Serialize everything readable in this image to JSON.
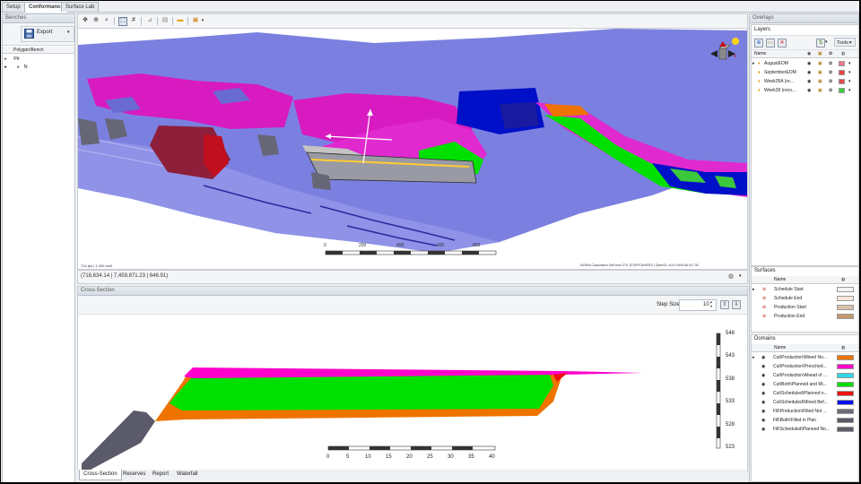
{
  "top_tabs": [
    "Setup",
    "Conformance",
    "Surface Lab"
  ],
  "benches": {
    "title": "Benches",
    "export_label": "Export",
    "column": "Polygon/Bench",
    "tree": [
      "Pit",
      "N"
    ]
  },
  "viewport": {
    "fps": "714 fps | 1.400 ms/f",
    "coords": "(718,634.14 | 7,459,871.23 | 646.91)",
    "gpu_info": "NVIDIA Corporation GeForce GTX 1070/PCIe/SSE2 | OpenGL v4.5.0 NVIDIA 417.35",
    "scale_labels": [
      "0",
      "200",
      "400",
      "600",
      "800"
    ]
  },
  "cross_section": {
    "title": "Cross-Section",
    "step_size_label": "Step Size",
    "step_size_value": "10",
    "elevation_labels": [
      "548",
      "543",
      "538",
      "533",
      "528",
      "523"
    ],
    "scale_labels": [
      "0",
      "5",
      "10",
      "15",
      "20",
      "25",
      "30",
      "35",
      "40"
    ]
  },
  "bottom_tabs": [
    "Cross-Section",
    "Reserves",
    "Report",
    "Waterfall"
  ],
  "overlays": {
    "title": "Overlays",
    "layers_label": "Layers",
    "tools_label": "Tools",
    "layers_column": "Name",
    "layers": [
      {
        "name": "AugustEOM",
        "color": "#f07a8a"
      },
      {
        "name": "SeptemberEOM",
        "color": "#e8463c"
      },
      {
        "name": "Week35A (re...",
        "color": "#e04a4a"
      },
      {
        "name": "Week39 (reco...",
        "color": "#3ccd3c"
      }
    ],
    "surfaces_label": "Surfaces",
    "surfaces_column": "Name",
    "surfaces": [
      {
        "name": "Schedule Start",
        "color": "#f4f4f4"
      },
      {
        "name": "Schedule End",
        "color": "#f9e6d8"
      },
      {
        "name": "Production Start",
        "color": "#dcc1a8"
      },
      {
        "name": "Production End",
        "color": "#c49a6c"
      }
    ],
    "domains_label": "Domains",
    "domains_column": "Name",
    "domains": [
      {
        "name": "Cut\\Production\\Mined No...",
        "color": "#ef7300"
      },
      {
        "name": "Cut\\Production\\Presched...",
        "color": "#ff00cc"
      },
      {
        "name": "Cut\\Production\\Ahead of ...",
        "color": "#33d6e8"
      },
      {
        "name": "Cut\\Both\\Planned and Mi...",
        "color": "#00e000"
      },
      {
        "name": "Cut\\Scheduled\\Planned n...",
        "color": "#ee1111"
      },
      {
        "name": "Cut\\Scheduled\\Mined Bef...",
        "color": "#0010ee"
      },
      {
        "name": "Fill\\Production\\Filled Not ...",
        "color": "#6c6c78"
      },
      {
        "name": "Fill\\Both\\Filled in Plan",
        "color": "#5a5a66"
      },
      {
        "name": "Fill\\Scheduled\\Planned No...",
        "color": "#5e5e6a"
      }
    ]
  }
}
